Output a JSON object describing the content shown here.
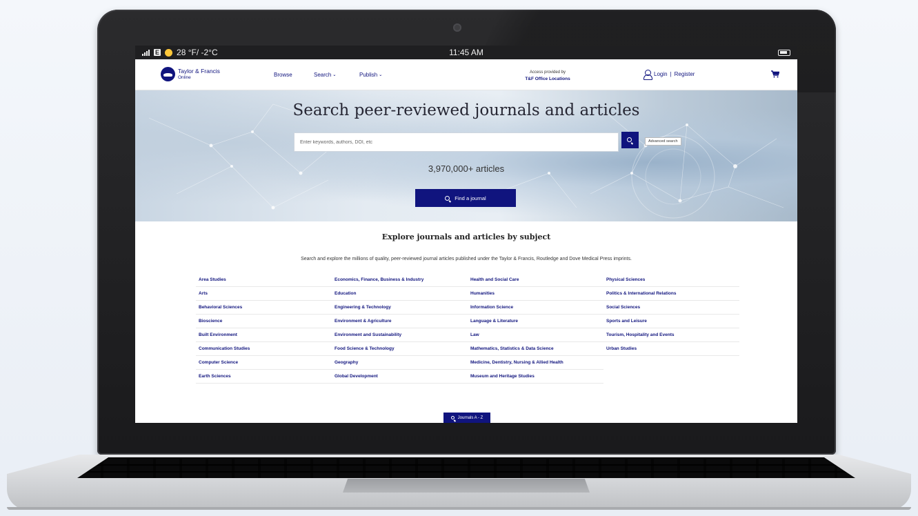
{
  "status_bar": {
    "network_type": "E",
    "weather": "28 °F/ -2°C",
    "time": "11:45 AM",
    "icons": [
      "signal-icon",
      "sun-icon",
      "battery-icon"
    ]
  },
  "header": {
    "brand_name": "Taylor & Francis",
    "brand_sub": "Online",
    "nav": [
      {
        "label": "Browse"
      },
      {
        "label": "Search"
      },
      {
        "label": "Publish"
      }
    ],
    "access_label": "Access provided by",
    "access_org": "T&F Office Locations",
    "login_label": "Login",
    "separator": "|",
    "register_label": "Register"
  },
  "hero": {
    "title": "Search peer-reviewed journals and articles",
    "search_placeholder": "Enter keywords, authors, DOI, etc",
    "advanced_search_label": "Advanced search",
    "article_count": "3,970,000+ articles",
    "find_journal_label": "Find a journal"
  },
  "explore": {
    "title": "Explore journals and articles by subject",
    "description": "Search and explore the millions of quality, peer-reviewed journal articles published under the Taylor & Francis, Routledge and Dove Medical Press imprints.",
    "columns": [
      [
        "Area Studies",
        "Arts",
        "Behavioral Sciences",
        "Bioscience",
        "Built Environment",
        "Communication Studies",
        "Computer Science",
        "Earth Sciences"
      ],
      [
        "Economics, Finance, Business & Industry",
        "Education",
        "Engineering & Technology",
        "Environment & Agriculture",
        "Environment and Sustainability",
        "Food Science & Technology",
        "Geography",
        "Global Development"
      ],
      [
        "Health and Social Care",
        "Humanities",
        "Information Science",
        "Language & Literature",
        "Law",
        "Mathematics, Statistics & Data Science",
        "Medicine, Dentistry, Nursing & Allied Health",
        "Museum and Heritage Studies"
      ],
      [
        "Physical Sciences",
        "Politics & International Relations",
        "Social Sciences",
        "Sports and Leisure",
        "Tourism, Hospitality and Events",
        "Urban Studies"
      ]
    ],
    "az_label": "Journals A - Z"
  },
  "colors": {
    "brand_navy": "#10147e",
    "frame_dark": "#1f1f21",
    "page_bg": "#ffffff"
  }
}
